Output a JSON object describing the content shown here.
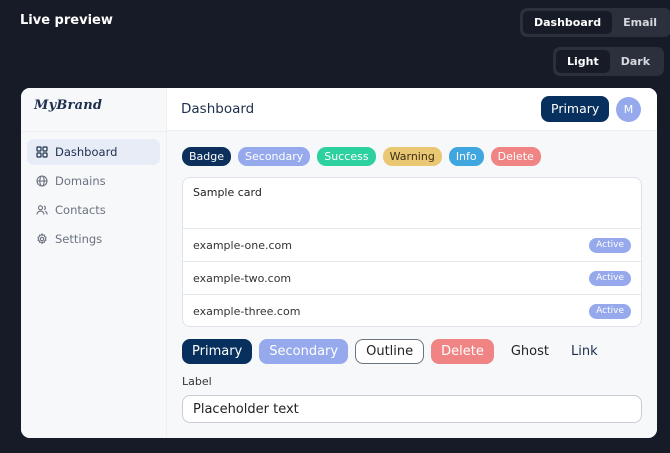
{
  "app": {
    "title": "Live preview"
  },
  "view_switch": {
    "options": [
      "Dashboard",
      "Email"
    ],
    "selected": "Dashboard"
  },
  "theme_switch": {
    "options": [
      "Light",
      "Dark"
    ],
    "selected": "Light"
  },
  "preview": {
    "brand": "MyBrand",
    "sidebar": {
      "items": [
        {
          "label": "Dashboard",
          "icon": "grid-icon",
          "active": true
        },
        {
          "label": "Domains",
          "icon": "globe-icon",
          "active": false
        },
        {
          "label": "Contacts",
          "icon": "users-icon",
          "active": false
        },
        {
          "label": "Settings",
          "icon": "gear-icon",
          "active": false
        }
      ]
    },
    "header": {
      "title": "Dashboard",
      "primary_label": "Primary",
      "avatar_initial": "M"
    },
    "badges": [
      "Badge",
      "Secondary",
      "Success",
      "Warning",
      "Info",
      "Delete"
    ],
    "card": {
      "title": "Sample card",
      "rows": [
        {
          "domain": "example-one.com",
          "status": "Active"
        },
        {
          "domain": "example-two.com",
          "status": "Active"
        },
        {
          "domain": "example-three.com",
          "status": "Active"
        }
      ]
    },
    "buttons": [
      "Primary",
      "Secondary",
      "Outline",
      "Delete",
      "Ghost",
      "Link"
    ],
    "form": {
      "label": "Label",
      "placeholder": "Placeholder text"
    }
  },
  "colors": {
    "page_bg": "#161b27",
    "primary": "#08305e",
    "secondary": "#95a9ec",
    "success": "#2dd1a0",
    "warning": "#eac873",
    "info": "#3fa6e0",
    "delete": "#f08484"
  }
}
